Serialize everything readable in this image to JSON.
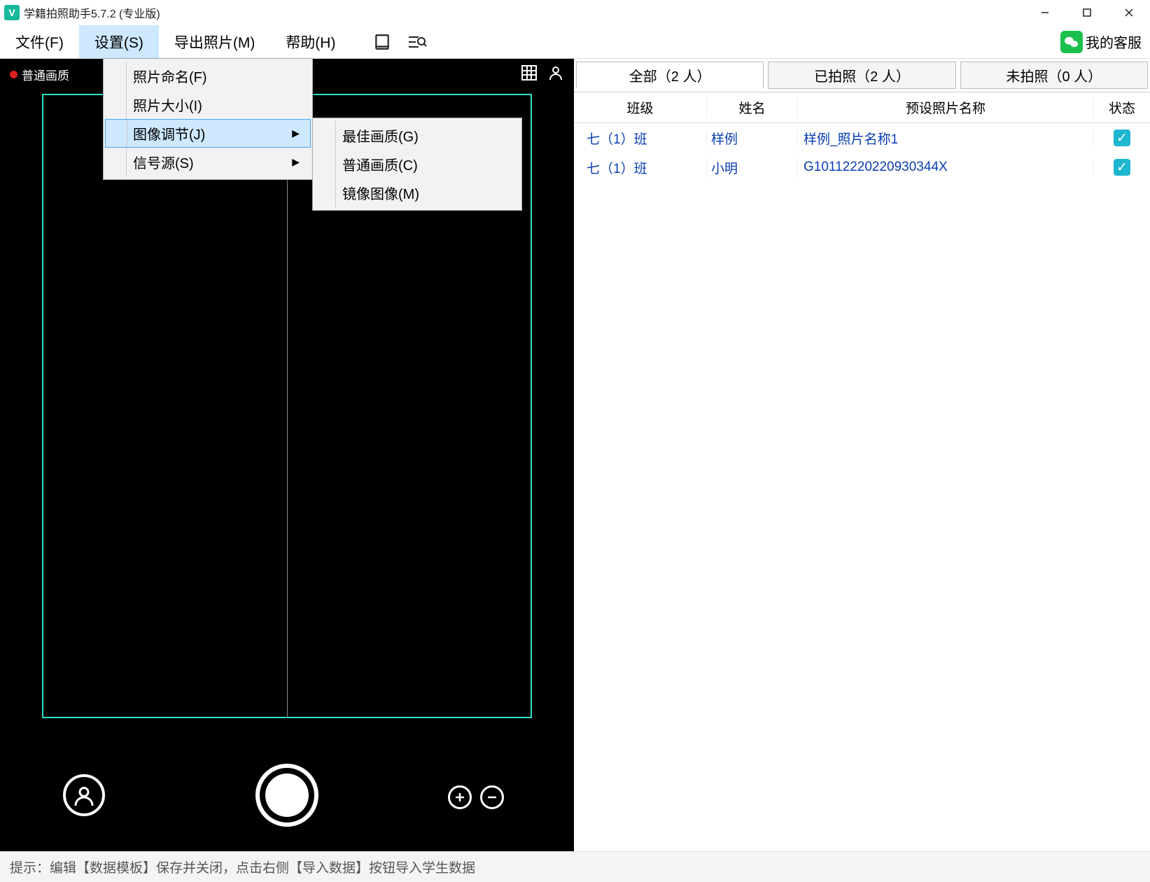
{
  "window": {
    "title": "学籍拍照助手5.7.2 (专业版)"
  },
  "menubar": {
    "file": "文件(F)",
    "settings": "设置(S)",
    "export": "导出照片(M)",
    "help": "帮助(H)",
    "support": "我的客服"
  },
  "settings_menu": {
    "photo_naming": "照片命名(F)",
    "photo_size": "照片大小(I)",
    "image_adjust": "图像调节(J)",
    "signal_source": "信号源(S)"
  },
  "image_adjust_submenu": {
    "best_quality": "最佳画质(G)",
    "normal_quality": "普通画质(C)",
    "mirror_image": "镜像图像(M)"
  },
  "camera": {
    "quality_label": "普通画质"
  },
  "tabs": {
    "all": "全部（2 人）",
    "taken": "已拍照（2 人）",
    "not_taken": "未拍照（0 人）"
  },
  "columns": {
    "class": "班级",
    "name": "姓名",
    "photo_name": "预设照片名称",
    "status": "状态"
  },
  "rows": [
    {
      "class": "七（1）班",
      "name": "样例",
      "photo": "样例_照片名称1"
    },
    {
      "class": "七（1）班",
      "name": "小明",
      "photo": "G10112220220930344X"
    }
  ],
  "status": "提示：编辑【数据模板】保存并关闭，点击右侧【导入数据】按钮导入学生数据"
}
